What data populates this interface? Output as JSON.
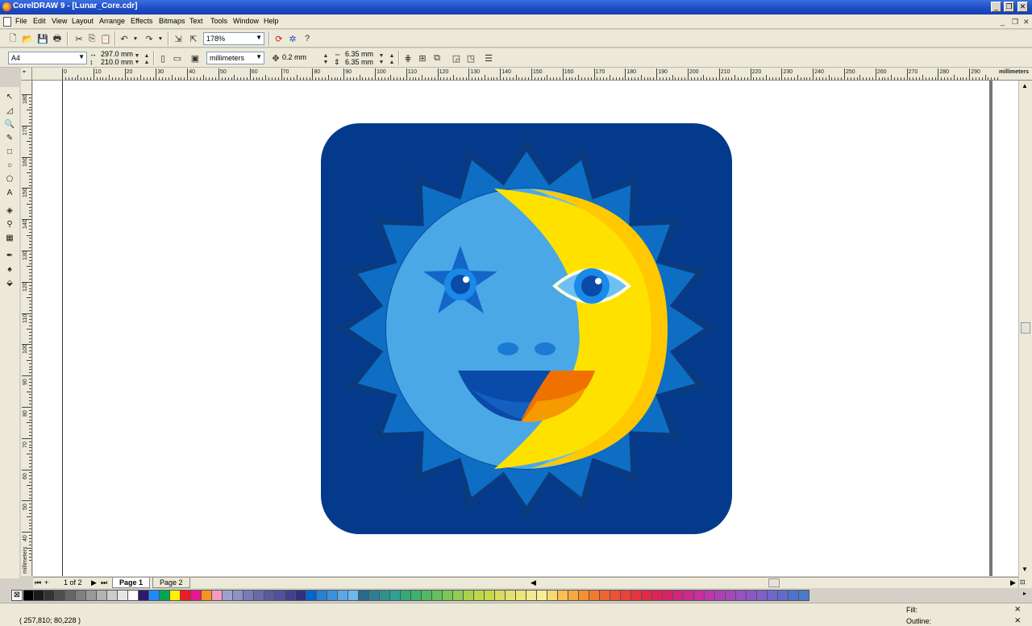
{
  "window": {
    "title": "CorelDRAW 9 - [Lunar_Core.cdr]"
  },
  "menu": [
    "File",
    "Edit",
    "View",
    "Layout",
    "Arrange",
    "Effects",
    "Bitmaps",
    "Text",
    "Tools",
    "Window",
    "Help"
  ],
  "standard_toolbar": {
    "zoom": "178%"
  },
  "property_bar": {
    "page_size": "A4",
    "width": "297.0 mm",
    "height": "210.0 mm",
    "units": "millimeters",
    "nudge": "0.2 mm",
    "dup_x": "6.35 mm",
    "dup_y": "6.35 mm"
  },
  "ruler": {
    "unit": "millimeters",
    "h_labels": [
      "0",
      "10",
      "20",
      "30",
      "40",
      "50",
      "60",
      "70",
      "80",
      "90",
      "100",
      "110",
      "120",
      "130",
      "140",
      "150",
      "160",
      "170",
      "180",
      "190",
      "200",
      "210",
      "220",
      "230",
      "240",
      "250",
      "260",
      "270",
      "280",
      "290"
    ],
    "v_labels": [
      "180",
      "170",
      "160",
      "150",
      "140",
      "130",
      "120",
      "110",
      "100",
      "90",
      "80",
      "70",
      "60",
      "50",
      "40"
    ]
  },
  "pages": {
    "counter": "1 of 2",
    "tabs": [
      "Page 1",
      "Page 2"
    ],
    "active": "Page 1"
  },
  "status": {
    "coords": "( 257,810; 80,228 )",
    "fill_label": "Fill:",
    "outline_label": "Outline:"
  },
  "palette": [
    "#000000",
    "#1a1a1a",
    "#333333",
    "#4d4d4d",
    "#666666",
    "#808080",
    "#999999",
    "#b3b3b3",
    "#cccccc",
    "#e6e6e6",
    "#ffffff",
    "#2e1a6b",
    "#1a8cff",
    "#00a651",
    "#ffef00",
    "#ed1c24",
    "#e8168c",
    "#f7941d",
    "#f49ac1",
    "#a0a0d0",
    "#9090c8",
    "#7a7ab8",
    "#6a6aa8",
    "#5a5a98",
    "#5050a0",
    "#404090",
    "#303080",
    "#0066cc",
    "#2a7fd4",
    "#3a90dd",
    "#5aa8e6",
    "#6eb8ee",
    "#2a6a8a",
    "#2e7e96",
    "#2f9090",
    "#30a090",
    "#34a878",
    "#3cb26a",
    "#50b860",
    "#64c05a",
    "#7cc656",
    "#90cc50",
    "#a8d24c",
    "#bcd848",
    "#c8d848",
    "#d8dc60",
    "#e6e070",
    "#f0e678",
    "#f4e890",
    "#f8ee98",
    "#f8d870",
    "#f8c050",
    "#f7a840",
    "#f59030",
    "#f27a30",
    "#ef6432",
    "#ec5236",
    "#e94238",
    "#e5343e",
    "#e02a48",
    "#dc2456",
    "#d82268",
    "#d4247a",
    "#cc2a8c",
    "#c4309c",
    "#bc38aa",
    "#b040b4",
    "#a448bc",
    "#9850c2",
    "#8c56c6",
    "#8060ca",
    "#7066cc",
    "#606ccc",
    "#5072cc",
    "#4a7acc"
  ],
  "artwork_colors": {
    "background": "#043a8c",
    "sun_rays": "#0d6ec4",
    "sun_outer": "#0f4a9e",
    "face": "#4aa8e6",
    "moon": "#ffd400",
    "mouth": "#0a50a8"
  }
}
